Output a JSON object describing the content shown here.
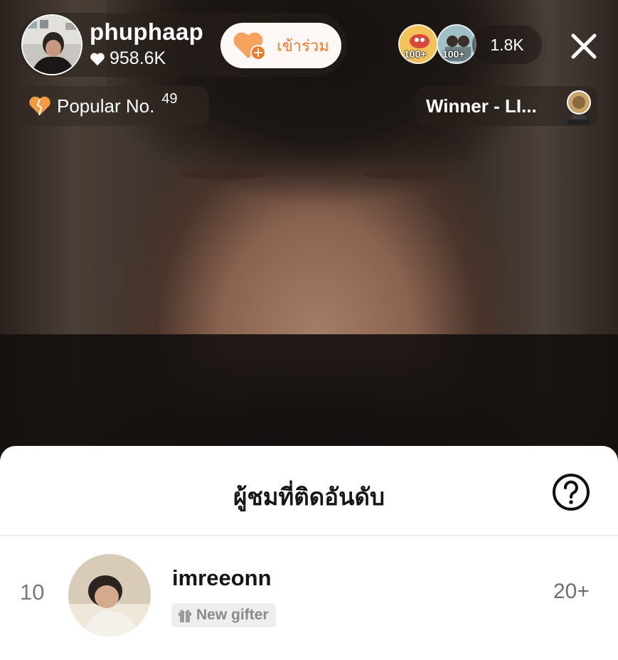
{
  "host": {
    "username": "phuphaap",
    "likes": "958.6K",
    "follow_label": "เข้าร่วม"
  },
  "viewers": {
    "badges": [
      "100+",
      "100+"
    ],
    "count": "1.8K"
  },
  "popular": {
    "label": "Popular No.",
    "rank": "49"
  },
  "winner": {
    "label": "Winner - LI..."
  },
  "sheet": {
    "title": "ผู้ชมที่ติดอันดับ",
    "rows": [
      {
        "rank": "10",
        "username": "imreeonn",
        "badge": "New gifter",
        "score": "20+"
      }
    ]
  },
  "icons": {
    "heart": "heart-icon",
    "follow": "heart-plus-icon",
    "close": "close-icon",
    "popular": "orange-heart-icon",
    "trophy": "trophy-icon",
    "help": "question-circle-icon",
    "gift": "gift-icon"
  },
  "colors": {
    "accent_orange": "#f07a2a",
    "sheet_bg": "#ffffff"
  }
}
